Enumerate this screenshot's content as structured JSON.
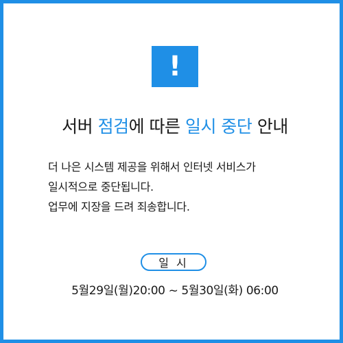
{
  "notice": {
    "alert_icon": "exclamation-icon",
    "alert_symbol": "!",
    "title": {
      "part1": "서버 ",
      "accent1": "점검",
      "part2": "에 따른 ",
      "accent2": "일시 중단",
      "part3": " 안내"
    },
    "body_lines": [
      "더 나은 시스템 제공을 위해서 인터넷 서비스가",
      "일시적으로 중단됩니다.",
      "업무에 지장을 드려 죄송합니다."
    ],
    "schedule_label": "일 시",
    "schedule_time": "5월29일(월)20:00 ~ 5월30일(화) 06:00"
  },
  "colors": {
    "accent": "#1f8fe6",
    "text": "#1a1a1a",
    "background": "#ffffff"
  }
}
